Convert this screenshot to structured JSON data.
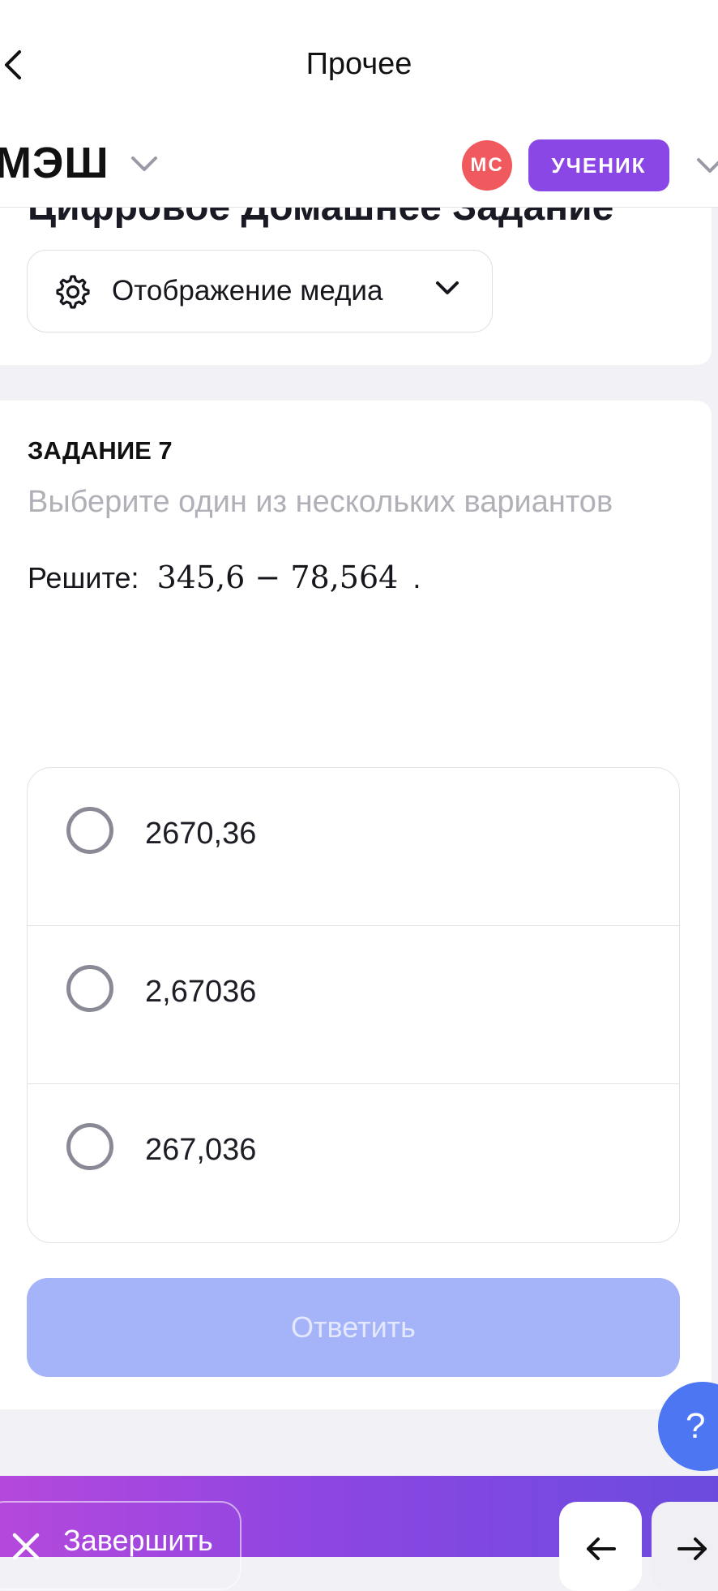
{
  "top_bar": {
    "title": "Прочее"
  },
  "brand": {
    "logo": "МЭШ"
  },
  "user": {
    "initials": "МС",
    "role": "УЧЕНИК"
  },
  "homework": {
    "title": "Цифровое Домашнее Задание",
    "media_dropdown_label": "Отображение медиа"
  },
  "task": {
    "number_label": "ЗАДАНИЕ 7",
    "hint": "Выберите один из нескольких вариантов",
    "question_prefix": "Решите:",
    "expression": "345,6 − 78,564",
    "question_suffix": ".",
    "options": [
      {
        "label": "2670,36"
      },
      {
        "label": "2,67036"
      },
      {
        "label": "267,036"
      }
    ],
    "answer_button": "Ответить"
  },
  "help": {
    "label": "?"
  },
  "bottom_bar": {
    "finish_label": "Завершить"
  },
  "colors": {
    "accent_purple": "#8b47e6",
    "avatar_red": "#f0595e",
    "answer_disabled": "#a5b4f8",
    "help_blue": "#4d76f3"
  },
  "icons": {
    "back": "chevron-left-icon",
    "dropdown": "chevron-down-icon",
    "settings": "gear-icon",
    "close": "close-icon",
    "prev": "arrow-left-icon",
    "next": "arrow-right-icon"
  }
}
